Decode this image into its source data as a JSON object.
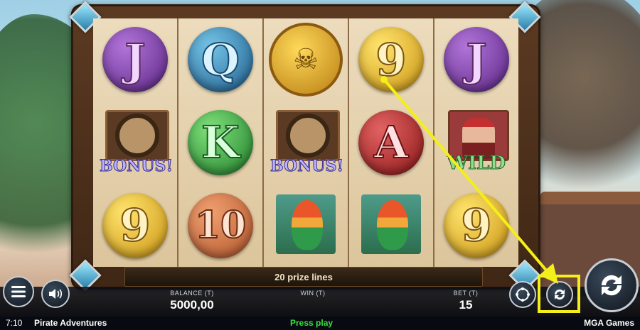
{
  "game": {
    "title": "Pirate Adventures",
    "provider": "MGA Games",
    "prize_lines_label": "20 prize lines"
  },
  "reels": [
    [
      {
        "type": "letter",
        "label": "J",
        "color": "purple"
      },
      {
        "type": "bonus",
        "label": "BONUS!"
      },
      {
        "type": "letter",
        "label": "9",
        "color": "gold"
      }
    ],
    [
      {
        "type": "letter",
        "label": "Q",
        "color": "blue"
      },
      {
        "type": "letter",
        "label": "K",
        "color": "green"
      },
      {
        "type": "letter",
        "label": "10",
        "color": "orange"
      }
    ],
    [
      {
        "type": "coin",
        "label": "☠"
      },
      {
        "type": "bonus",
        "label": "BONUS!"
      },
      {
        "type": "parrot",
        "label": ""
      }
    ],
    [
      {
        "type": "letter",
        "label": "9",
        "color": "gold"
      },
      {
        "type": "letter",
        "label": "A",
        "color": "red"
      },
      {
        "type": "parrot",
        "label": ""
      }
    ],
    [
      {
        "type": "letter",
        "label": "J",
        "color": "purple"
      },
      {
        "type": "wild",
        "label": "WILD"
      },
      {
        "type": "letter",
        "label": "9",
        "color": "gold"
      }
    ]
  ],
  "stats": {
    "balance_caption": "BALANCE (T)",
    "balance_value": "5000,00",
    "win_caption": "WIN (T)",
    "win_value": "",
    "bet_caption": "BET (T)",
    "bet_value": "15"
  },
  "status": {
    "time": "7:10",
    "message": "Press play"
  },
  "colors": {
    "highlight": "#f4ee1a",
    "press_play": "#39e03a"
  },
  "icons": {
    "menu": "menu-icon",
    "sound": "speaker-icon",
    "autoplay": "autoplay-icon",
    "turbo": "turbo-icon",
    "spin": "spin-icon"
  }
}
